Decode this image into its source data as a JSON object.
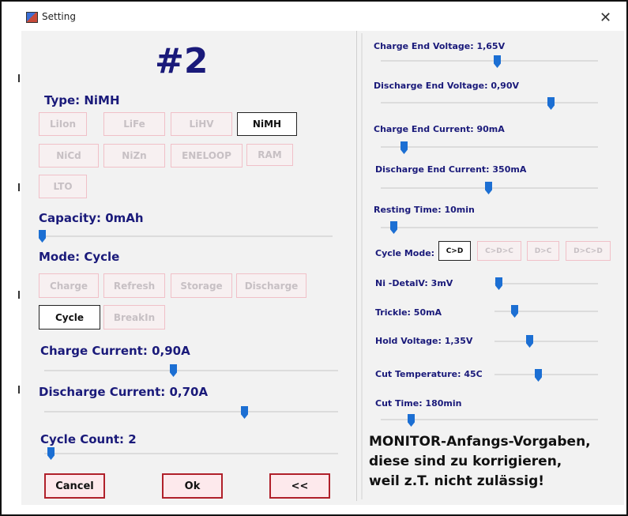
{
  "window": {
    "title": "Setting",
    "close_icon": "close-icon"
  },
  "profile": {
    "number": "#2"
  },
  "type": {
    "label": "Type:  NiMH",
    "options": [
      "LiIon",
      "LiFe",
      "LiHV",
      "NiMH",
      "NiCd",
      "NiZn",
      "ENELOOP",
      "RAM",
      "LTO"
    ],
    "selected": "NiMH"
  },
  "capacity": {
    "label": "Capacity:  0mAh",
    "level": 0
  },
  "mode": {
    "label": "Mode:  Cycle",
    "options": [
      "Charge",
      "Refresh",
      "Storage",
      "Discharge",
      "Cycle",
      "BreakIn"
    ],
    "selected": "Cycle"
  },
  "charge_current": {
    "label": "Charge Current:  0,90A",
    "level": 0.44
  },
  "discharge_current": {
    "label": "Discharge Current:  0,70A",
    "level": 0.68
  },
  "cycle_count": {
    "label": "Cycle Count:  2",
    "level": 0.02
  },
  "buttons": {
    "cancel": "Cancel",
    "ok": "Ok",
    "back": "<<"
  },
  "right": {
    "charge_end_voltage": {
      "label": "Charge End Voltage:  1,65V",
      "level": 0.54
    },
    "discharge_end_voltage": {
      "label": "Discharge End Voltage:  0,90V",
      "level": 0.8
    },
    "charge_end_current": {
      "label": "Charge End Current:  90mA",
      "level": 0.1
    },
    "discharge_end_current": {
      "label": "Discharge End Current:  350mA",
      "level": 0.5
    },
    "resting_time": {
      "label": "Resting Time:  10min",
      "level": 0.06
    },
    "cycle_mode": {
      "label": "Cycle Mode:",
      "options": [
        "C>D",
        "C>D>C",
        "D>C",
        "D>C>D"
      ],
      "selected": "C>D"
    },
    "ni_delta_v": {
      "label": "Ni -DetalV:  3mV",
      "level": 0.02
    },
    "trickle": {
      "label": "Trickle:  50mA",
      "level": 0.2
    },
    "hold_voltage": {
      "label": "Hold Voltage:  1,35V",
      "level": 0.3
    },
    "cut_temperature": {
      "label": "Cut Temperature:  45C",
      "level": 0.4
    },
    "cut_time": {
      "label": "Cut Time:  180min",
      "level": 0.13
    }
  },
  "annotation": {
    "line1": "MONITOR-Anfangs-Vorgaben,",
    "line2": "diese sind zu korrigieren,",
    "line3": "weil z.T. nicht zulässig!"
  }
}
